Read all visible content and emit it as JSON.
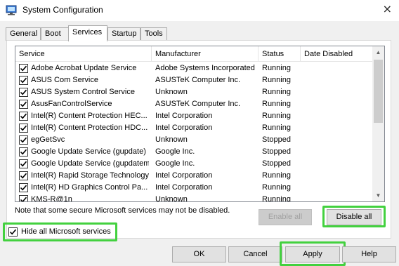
{
  "window": {
    "title": "System Configuration",
    "close_glyph": "×"
  },
  "tabs": [
    {
      "label": "General"
    },
    {
      "label": "Boot"
    },
    {
      "label": "Services",
      "active": true
    },
    {
      "label": "Startup"
    },
    {
      "label": "Tools"
    }
  ],
  "columns": {
    "service": "Service",
    "manufacturer": "Manufacturer",
    "status": "Status",
    "date_disabled": "Date Disabled"
  },
  "services": [
    {
      "name": "Adobe Acrobat Update Service",
      "manufacturer": "Adobe Systems Incorporated",
      "status": "Running",
      "checked": true
    },
    {
      "name": "ASUS Com Service",
      "manufacturer": "ASUSTeK Computer Inc.",
      "status": "Running",
      "checked": true
    },
    {
      "name": "ASUS System Control Service",
      "manufacturer": "Unknown",
      "status": "Running",
      "checked": true
    },
    {
      "name": "AsusFanControlService",
      "manufacturer": "ASUSTeK Computer Inc.",
      "status": "Running",
      "checked": true
    },
    {
      "name": "Intel(R) Content Protection HEC...",
      "manufacturer": "Intel Corporation",
      "status": "Running",
      "checked": true
    },
    {
      "name": "Intel(R) Content Protection HDC...",
      "manufacturer": "Intel Corporation",
      "status": "Running",
      "checked": true
    },
    {
      "name": "egGetSvc",
      "manufacturer": "Unknown",
      "status": "Stopped",
      "checked": true
    },
    {
      "name": "Google Update Service (gupdate)",
      "manufacturer": "Google Inc.",
      "status": "Stopped",
      "checked": true
    },
    {
      "name": "Google Update Service (gupdatem)",
      "manufacturer": "Google Inc.",
      "status": "Stopped",
      "checked": true
    },
    {
      "name": "Intel(R) Rapid Storage Technology",
      "manufacturer": "Intel Corporation",
      "status": "Running",
      "checked": true
    },
    {
      "name": "Intel(R) HD Graphics Control Pa...",
      "manufacturer": "Intel Corporation",
      "status": "Running",
      "checked": true
    },
    {
      "name": "KMS-R@1n",
      "manufacturer": "Unknown",
      "status": "Running",
      "checked": true
    }
  ],
  "scrollbar": {
    "up": "▲",
    "down": "▼"
  },
  "note": "Note that some secure Microsoft services may not be disabled.",
  "buttons": {
    "enable_all": "Enable all",
    "disable_all": "Disable all",
    "ok": "OK",
    "cancel": "Cancel",
    "apply": "Apply",
    "help": "Help"
  },
  "hide_ms": {
    "label": "Hide all Microsoft services",
    "checked": true
  },
  "highlight_color": "#43d13f"
}
